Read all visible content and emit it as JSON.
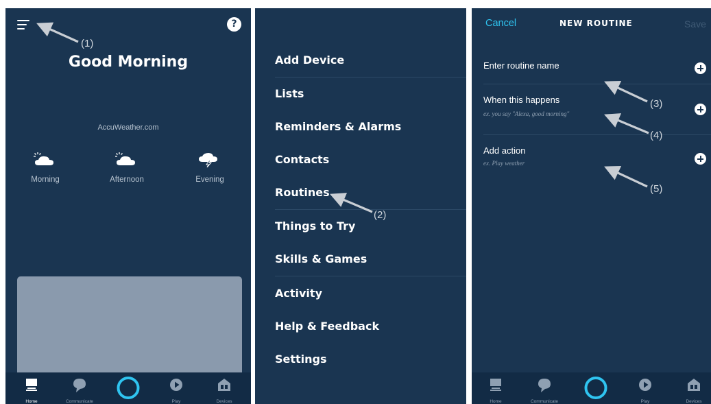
{
  "home": {
    "greeting": "Good Morning",
    "weather_source": "AccuWeather.com",
    "forecast": [
      {
        "label": "Morning",
        "icon": "partly-cloudy-icon"
      },
      {
        "label": "Afternoon",
        "icon": "partly-cloudy-icon"
      },
      {
        "label": "Evening",
        "icon": "thunderstorm-icon"
      }
    ],
    "annotation": "(1)"
  },
  "menu": {
    "items": [
      "Add Device",
      "Lists",
      "Reminders & Alarms",
      "Contacts",
      "Routines",
      "Things to Try",
      "Skills & Games",
      "Activity",
      "Help & Feedback",
      "Settings"
    ],
    "annotation": "(2)"
  },
  "routine": {
    "cancel": "Cancel",
    "title": "NEW ROUTINE",
    "save": "Save",
    "rows": [
      {
        "title": "Enter routine name",
        "subtitle": ""
      },
      {
        "title": "When this happens",
        "subtitle": "ex. you say \"Alexa, good morning\""
      },
      {
        "title": "Add action",
        "subtitle": "ex. Play weather"
      }
    ],
    "annotations": [
      "(3)",
      "(4)",
      "(5)"
    ]
  },
  "nav": {
    "items": [
      "Home",
      "Communicate",
      "",
      "Play",
      "Devices"
    ],
    "active": "Home",
    "colors": {
      "accent": "#2fc4f0",
      "background": "#1a3551"
    }
  }
}
